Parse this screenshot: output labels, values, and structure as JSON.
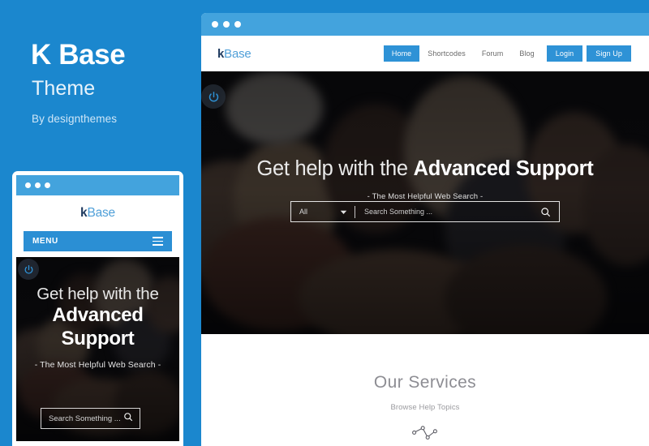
{
  "promo": {
    "title": "K Base",
    "subtitle": "Theme",
    "author": "By designthemes"
  },
  "colors": {
    "brand_blue": "#1b87ce",
    "titlebar_blue": "#43a3dd",
    "nav_active_blue": "#2e92d6",
    "logo_dark": "#1e3a5f",
    "logo_light": "#4f9fd8"
  },
  "browser": {
    "titlebar": {
      "dots": [
        "dot-1",
        "dot-2",
        "dot-3"
      ]
    },
    "logo": {
      "k": "k",
      "base": "Base"
    },
    "nav": [
      {
        "label": "Home",
        "style": "active"
      },
      {
        "label": "Shortcodes",
        "style": "plain"
      },
      {
        "label": "Forum",
        "style": "plain"
      },
      {
        "label": "Blog",
        "style": "plain"
      },
      {
        "label": "Login",
        "style": "button"
      },
      {
        "label": "Sign Up",
        "style": "button"
      }
    ],
    "hero": {
      "power_icon": "power-icon",
      "heading_thin": "Get help with the ",
      "heading_bold": "Advanced Support",
      "tagline": "-  The Most Helpful Web Search  -",
      "search": {
        "category_value": "All",
        "category_icon": "chevron-down-icon",
        "placeholder": "Search Something ...",
        "submit_icon": "search-icon"
      }
    },
    "services": {
      "title": "Our Services",
      "subtitle": "Browse Help Topics",
      "icon": "connected-nodes-icon"
    }
  },
  "mobile": {
    "titlebar": {
      "dots": [
        "dot-1",
        "dot-2",
        "dot-3"
      ]
    },
    "logo": {
      "k": "k",
      "base": "Base"
    },
    "menu": {
      "label": "MENU",
      "icon": "hamburger-icon"
    },
    "hero": {
      "power_icon": "power-icon",
      "heading_line1": "Get help with the",
      "heading_line2_a": "Advanced",
      "heading_line2_b": "Support",
      "tagline": "-  The Most Helpful Web Search  -",
      "search": {
        "placeholder": "Search Something ...",
        "submit_icon": "search-icon"
      }
    }
  }
}
